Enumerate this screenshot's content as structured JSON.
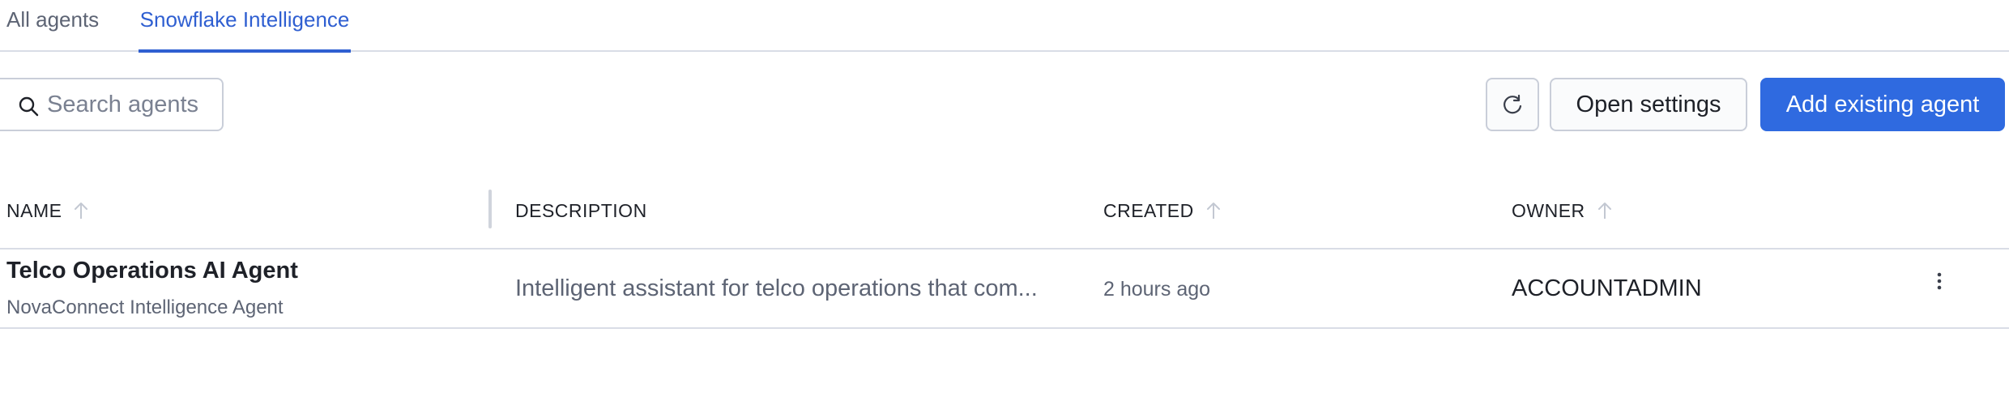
{
  "tabs": [
    {
      "label": "All agents",
      "active": false
    },
    {
      "label": "Snowflake Intelligence",
      "active": true
    }
  ],
  "toolbar": {
    "search_placeholder": "Search agents",
    "search_value": "",
    "refresh_icon": "refresh-icon",
    "settings_label": "Open settings",
    "add_label": "Add existing agent"
  },
  "table": {
    "columns": [
      {
        "label": "NAME",
        "sortable": true
      },
      {
        "label": "DESCRIPTION",
        "sortable": false
      },
      {
        "label": "CREATED",
        "sortable": true
      },
      {
        "label": "OWNER",
        "sortable": true
      }
    ],
    "rows": [
      {
        "name": "Telco Operations AI Agent",
        "subtitle": "NovaConnect Intelligence Agent",
        "description": "Intelligent assistant for telco operations that com...",
        "created": "2 hours ago",
        "owner": "ACCOUNTADMIN",
        "actions_icon": "more-vertical-icon"
      }
    ]
  },
  "colors": {
    "accent": "#2f6ae0",
    "tab_active": "#2f5fd1",
    "text": "#1e2128",
    "muted": "#5d6474",
    "border": "#c9ced9"
  }
}
